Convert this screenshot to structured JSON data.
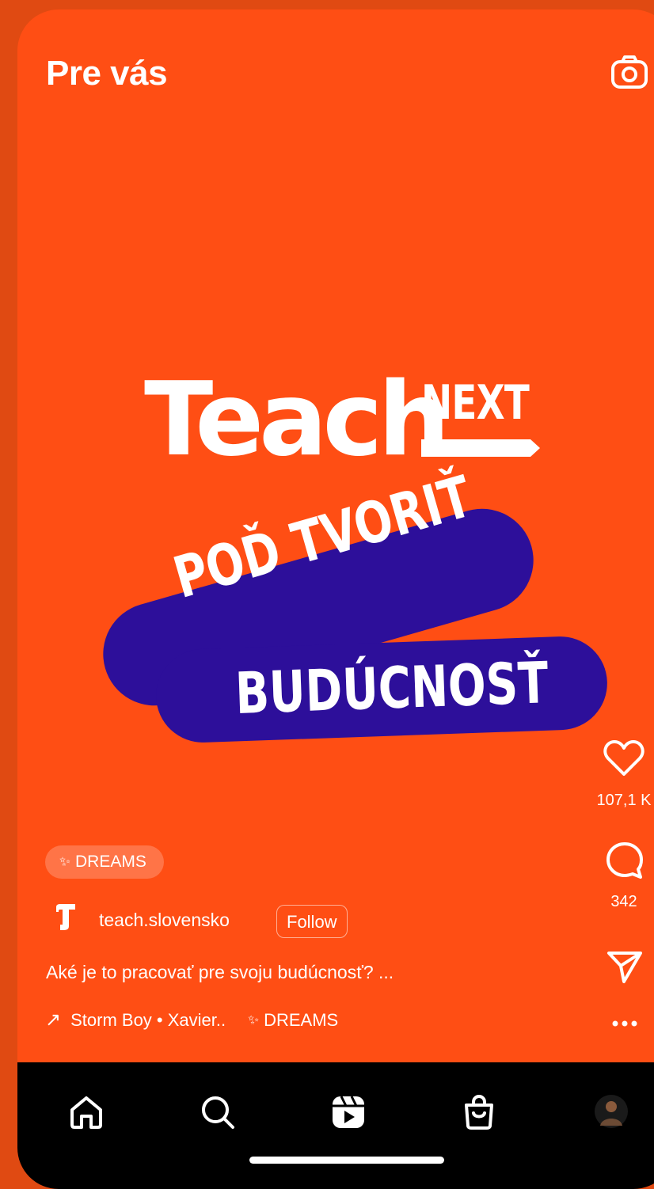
{
  "header": {
    "title": "Pre vás",
    "camera_icon": "camera-icon"
  },
  "post": {
    "logo_text": "Teach",
    "logo_suffix": "NEXT",
    "headline_line1": "POĎ TVORIŤ",
    "headline_line2": "BUDÚCNOSŤ",
    "accent_color": "#ff4e14",
    "pill_color": "#2d0f9a"
  },
  "rail": {
    "likes": "107,1 K",
    "comments": "342"
  },
  "info": {
    "tag": "DREAMS",
    "account": "teach.slovensko",
    "follow_label": "Follow",
    "caption": "Aké je to pracovať pre svoju budúcnosť? ...",
    "music": "Storm Boy • Xavier..",
    "music_tag": "DREAMS"
  },
  "nav": {
    "items": [
      "home-icon",
      "search-icon",
      "reels-icon",
      "shop-icon",
      "profile-avatar"
    ]
  }
}
